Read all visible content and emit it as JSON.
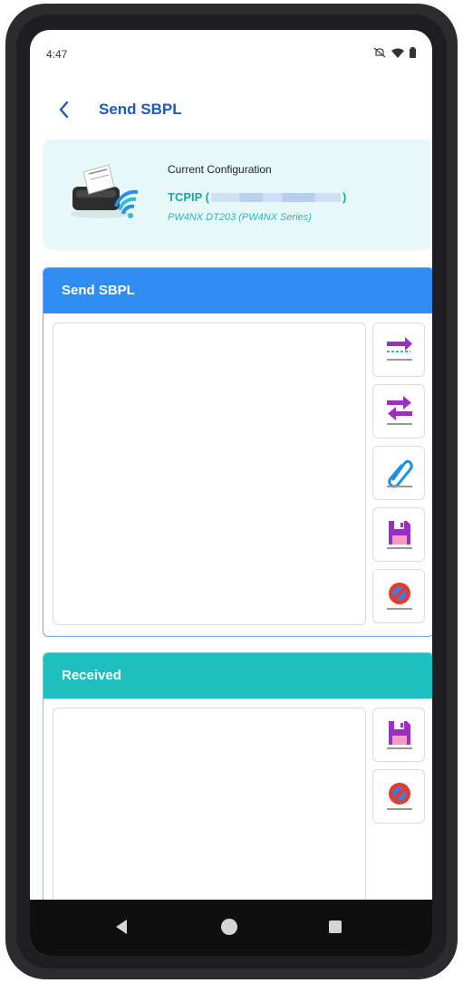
{
  "status_bar": {
    "time": "4:47"
  },
  "header": {
    "title": "Send SBPL"
  },
  "config": {
    "label": "Current Configuration",
    "connection_prefix": "TCPIP (",
    "connection_suffix": ")",
    "model": "PW4NX DT203 (PW4NX Series)"
  },
  "send_panel": {
    "title": "Send SBPL",
    "content": ""
  },
  "received_panel": {
    "title": "Received",
    "content": ""
  },
  "colors": {
    "title_blue": "#1f5bb5",
    "send_header": "#2f8cf0",
    "received_header": "#1ebfbf",
    "config_bg": "#e6f8f8",
    "teal_text": "#17a8a8",
    "purple_icon": "#9b2fc2"
  },
  "icons": {
    "send_tools": [
      "send-data-icon",
      "send-receive-icon",
      "attach-file-icon",
      "save-icon",
      "clear-icon"
    ],
    "received_tools": [
      "save-icon",
      "clear-icon"
    ]
  }
}
